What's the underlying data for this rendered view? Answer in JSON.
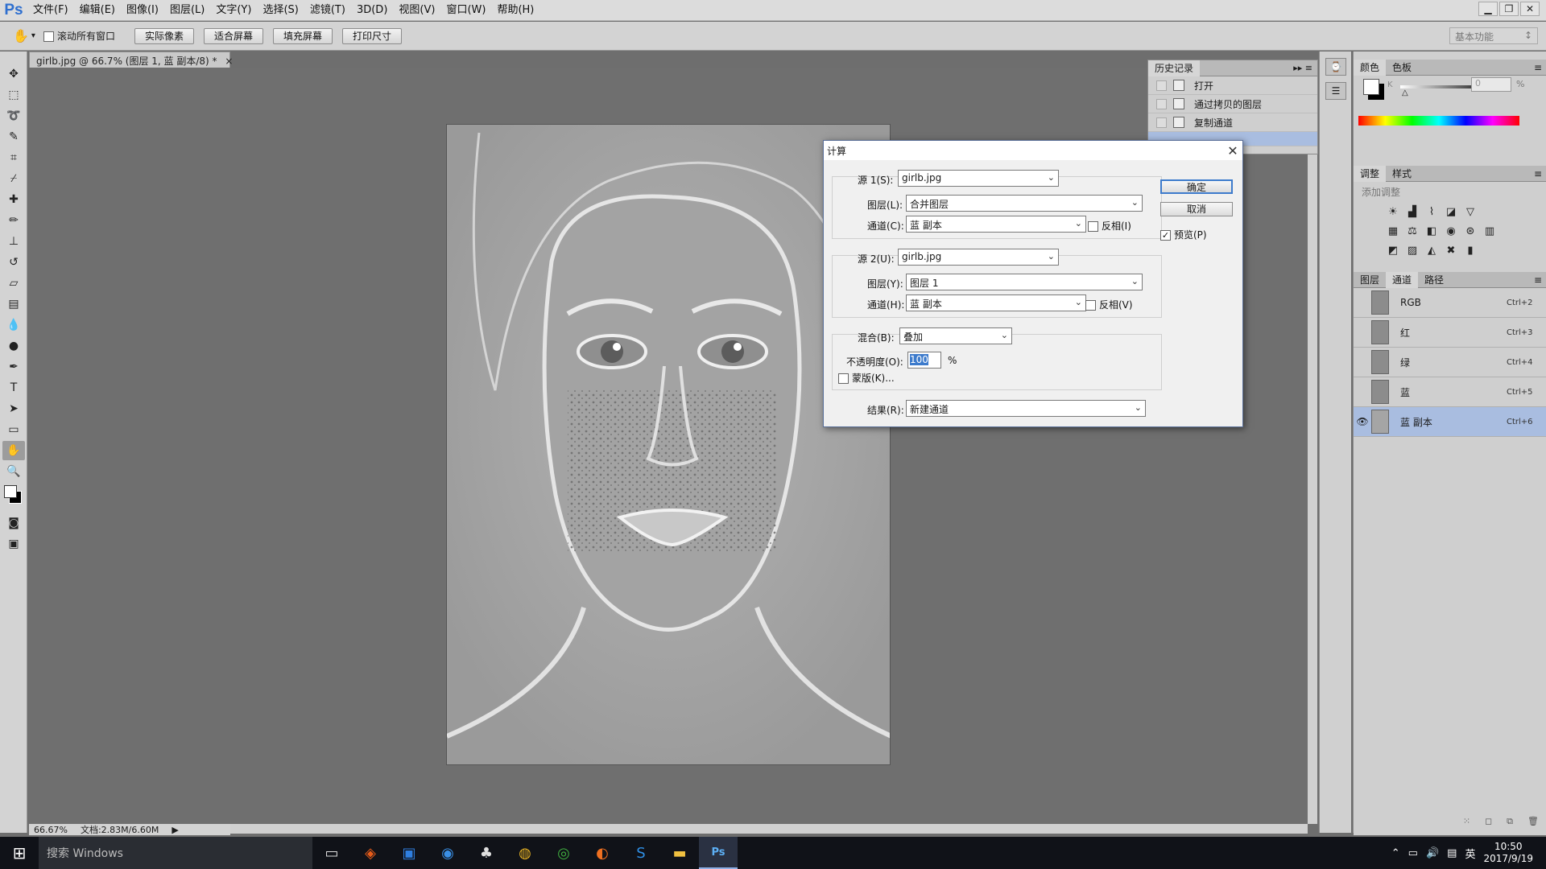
{
  "app": {
    "logo": "Ps"
  },
  "menu": [
    "文件(F)",
    "编辑(E)",
    "图像(I)",
    "图层(L)",
    "文字(Y)",
    "选择(S)",
    "滤镜(T)",
    "3D(D)",
    "视图(V)",
    "窗口(W)",
    "帮助(H)"
  ],
  "window_controls": {
    "minimize": "▁",
    "restore": "❐",
    "close": "✕"
  },
  "options": {
    "scroll_all_label": "滚动所有窗口",
    "buttons": [
      "实际像素",
      "适合屏幕",
      "填充屏幕",
      "打印尺寸"
    ],
    "workspace": "基本功能"
  },
  "document": {
    "tab_title": "girlb.jpg @ 66.7% (图层 1, 蓝 副本/8) *",
    "close": "×",
    "zoom": "66.67%",
    "doc_size": "文档:2.83M/6.60M"
  },
  "history": {
    "tab": "历史记录",
    "items": [
      "打开",
      "通过拷贝的图层",
      "复制通道"
    ]
  },
  "color_panel": {
    "tabs": [
      "颜色",
      "色板"
    ],
    "channel_label": "K",
    "value": "0",
    "unit": "%"
  },
  "adjustments": {
    "tabs": [
      "调整",
      "样式"
    ],
    "hint": "添加调整"
  },
  "channels": {
    "tabs": [
      "图层",
      "通道",
      "路径"
    ],
    "rows": [
      {
        "name": "RGB",
        "shortcut": "Ctrl+2"
      },
      {
        "name": "红",
        "shortcut": "Ctrl+3"
      },
      {
        "name": "绿",
        "shortcut": "Ctrl+4"
      },
      {
        "name": "蓝",
        "shortcut": "Ctrl+5"
      },
      {
        "name": "蓝 副本",
        "shortcut": "Ctrl+6"
      }
    ]
  },
  "dialog": {
    "title": "计算",
    "close": "✕",
    "ok": "确定",
    "cancel": "取消",
    "preview": "预览(P)",
    "source1": {
      "label": "源 1(S):",
      "file": "girlb.jpg",
      "layer_label": "图层(L):",
      "layer": "合并图层",
      "channel_label": "通道(C):",
      "channel": "蓝 副本",
      "invert": "反相(I)"
    },
    "source2": {
      "label": "源 2(U):",
      "file": "girlb.jpg",
      "layer_label": "图层(Y):",
      "layer": "图层 1",
      "channel_label": "通道(H):",
      "channel": "蓝 副本",
      "invert": "反相(V)"
    },
    "blend_label": "混合(B):",
    "blend": "叠加",
    "opacity_label": "不透明度(O):",
    "opacity": "100",
    "opacity_unit": "%",
    "mask": "蒙版(K)...",
    "result_label": "结果(R):",
    "result": "新建通道"
  },
  "taskbar": {
    "start": "⊞",
    "search_placeholder": "搜索 Windows",
    "lang": "英",
    "time": "10:50",
    "date": "2017/9/19"
  }
}
